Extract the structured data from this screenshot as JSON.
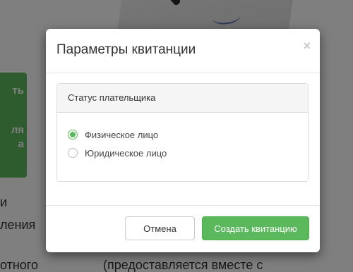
{
  "background": {
    "card_lines": [
      "ть",
      "ля",
      "а"
    ],
    "text_lines": [
      "и",
      "ления",
      "отного"
    ],
    "bottom_text": "(предоставляется вместе с"
  },
  "modal": {
    "title": "Параметры квитанции",
    "close_symbol": "×",
    "panel": {
      "heading": "Статус плательщика",
      "options": [
        {
          "label": "Физическое лицо",
          "checked": true
        },
        {
          "label": "Юридическое лицо",
          "checked": false
        }
      ]
    },
    "footer": {
      "cancel_label": "Отмена",
      "create_label": "Создать квитанцию"
    }
  },
  "colors": {
    "accent": "#5cb85c",
    "overlay": "rgba(0,0,0,0.5)"
  }
}
